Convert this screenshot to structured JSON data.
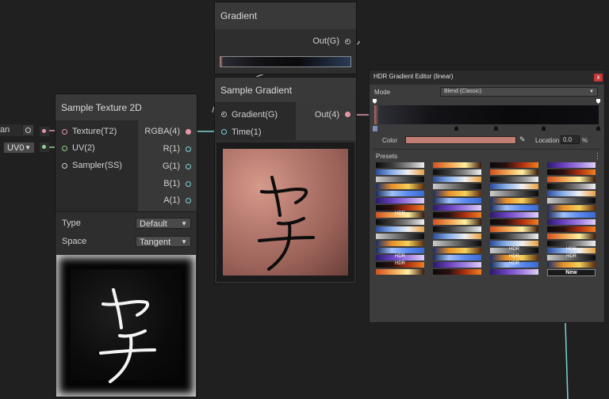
{
  "left_edge": {
    "tangent_label": "an",
    "uv_dropdown": "UV0"
  },
  "sample_texture": {
    "title": "Sample Texture 2D",
    "inputs": [
      "Texture(T2)",
      "UV(2)",
      "Sampler(SS)"
    ],
    "outputs": [
      "RGBA(4)",
      "R(1)",
      "G(1)",
      "B(1)",
      "A(1)"
    ],
    "type_label": "Type",
    "type_value": "Default",
    "space_label": "Space",
    "space_value": "Tangent"
  },
  "gradient_node": {
    "title": "Gradient",
    "output": "Out(G)"
  },
  "sample_gradient": {
    "title": "Sample Gradient",
    "inputs": [
      "Gradient(G)",
      "Time(1)"
    ],
    "output": "Out(4)"
  },
  "preview_text": "ヤチ",
  "editor": {
    "title": "HDR Gradient Editor (linear)",
    "close_label": "x",
    "mode_label": "Mode",
    "mode_value": "Blend (Classic)",
    "color_label": "Color",
    "color_value": "#c07f73",
    "location_label": "Location",
    "location_value": "0.0",
    "location_unit": "%",
    "presets_label": "Presets",
    "presets_menu": "⋮",
    "preset_tags": [
      "HDR",
      "HDR",
      "HDR",
      "HDR",
      "HDR",
      "HDR",
      "HDR",
      "HDR"
    ],
    "new_label": "New"
  },
  "colors": {
    "background": "#202020",
    "node_body": "#2e2e2e",
    "node_header": "#393939",
    "accent_pink": "#e597a8",
    "accent_cyan": "#7fd3d8",
    "accent_green": "#8ed38e",
    "texture_tint": "#c07f73"
  }
}
